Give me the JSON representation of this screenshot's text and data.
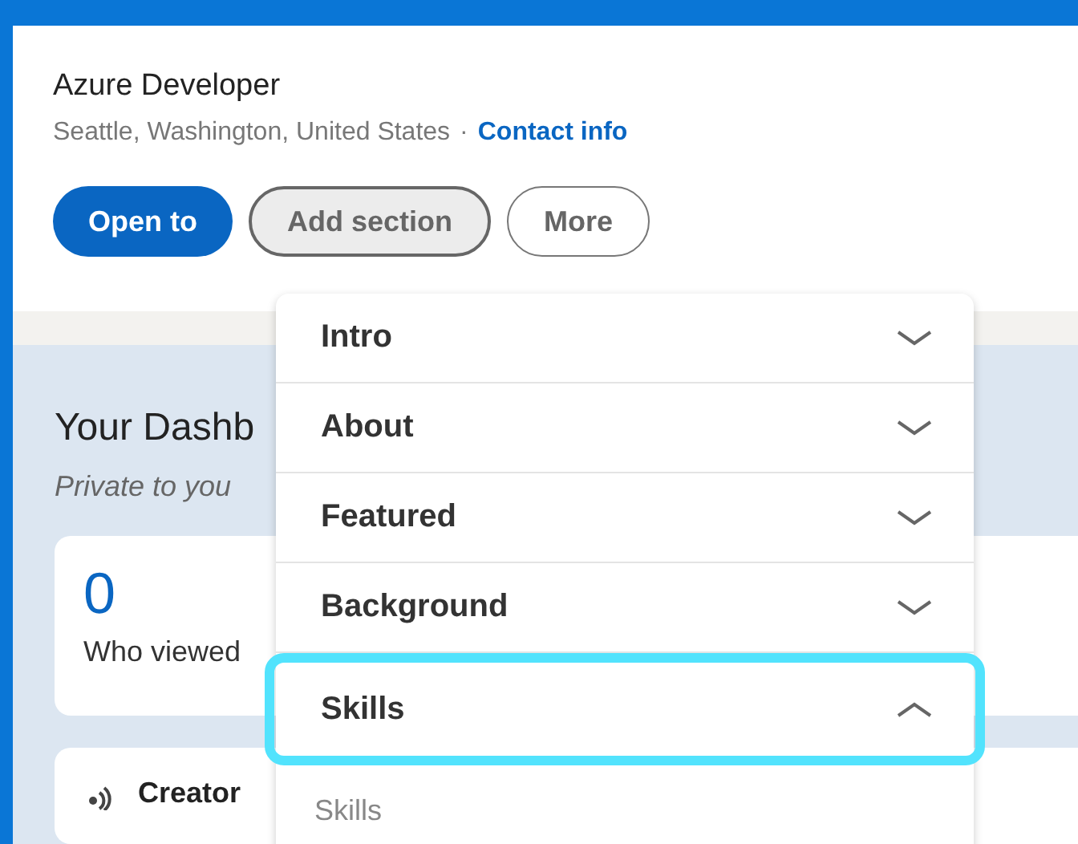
{
  "profile": {
    "headline": "Azure Developer",
    "location": "Seattle, Washington, United States",
    "separator": "·",
    "contact_link": "Contact info"
  },
  "actions": [
    {
      "label": "Open to",
      "kind": "primary",
      "selected": false
    },
    {
      "label": "Add section",
      "kind": "outline",
      "selected": true
    },
    {
      "label": "More",
      "kind": "outline",
      "selected": false
    }
  ],
  "dashboard": {
    "title": "Your Dashb",
    "subtitle": "Private to you",
    "stat_value": "0",
    "stat_label": "Who viewed",
    "creator_label": "Creator"
  },
  "menu": {
    "items": [
      {
        "label": "Intro",
        "expanded": false,
        "highlighted": false
      },
      {
        "label": "About",
        "expanded": false,
        "highlighted": false
      },
      {
        "label": "Featured",
        "expanded": false,
        "highlighted": false
      },
      {
        "label": "Background",
        "expanded": false,
        "highlighted": false
      },
      {
        "label": "Skills",
        "expanded": true,
        "highlighted": true,
        "children": [
          {
            "label": "Skills"
          }
        ]
      }
    ]
  }
}
